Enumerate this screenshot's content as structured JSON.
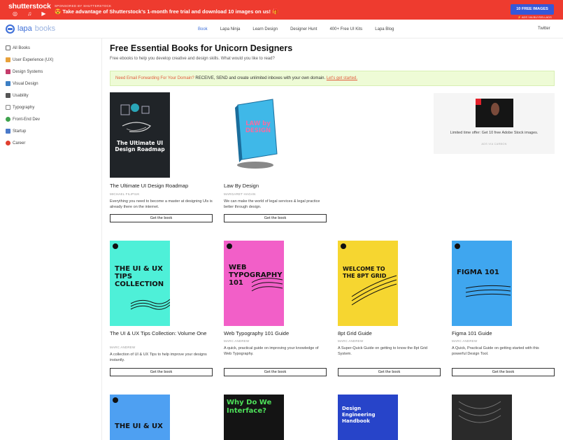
{
  "ad": {
    "logo": "shutterstock",
    "icons": "◎ ♫ ▶",
    "sponsor": "SPONSORED BY SHUTTERSTOCK",
    "text": "😍 Take advantage of Shutterstock's 1-month free trial and download 10 images on us! 🎁",
    "button": "10 FREE IMAGES",
    "via": "⚡ ADS VIA BUYSELLADS"
  },
  "brand": {
    "name": "lapa",
    "sub": "books"
  },
  "nav": {
    "items": [
      "Book",
      "Lapa Ninja",
      "Learn Design",
      "Designer Hunt",
      "400+ Free UI Kits",
      "Lapa Blog"
    ],
    "twitter": "Twitter"
  },
  "sidebar": {
    "items": [
      {
        "label": "All Books",
        "icon": "book-icon",
        "color": "#6a6a6a"
      },
      {
        "label": "User Experience (UX)",
        "icon": "pencil-icon",
        "color": "#e8a13a"
      },
      {
        "label": "Design Systems",
        "icon": "brush-icon",
        "color": "#c43c6b"
      },
      {
        "label": "Visual Design",
        "icon": "palette-icon",
        "color": "#3c7fc4"
      },
      {
        "label": "Usability",
        "icon": "grid-icon",
        "color": "#666666"
      },
      {
        "label": "Typography",
        "icon": "type-icon",
        "color": "#8a8a8a"
      },
      {
        "label": "Front-End Dev",
        "icon": "globe-icon",
        "color": "#3fa34d"
      },
      {
        "label": "Startup",
        "icon": "rocket-icon",
        "color": "#4a79c9"
      },
      {
        "label": "Career",
        "icon": "target-icon",
        "color": "#e0402f"
      }
    ]
  },
  "main": {
    "title": "Free Essential Books for Unicorn Designers",
    "subtitle": "Free ebooks to help you develop creative and design skills. What would you like to read?",
    "promo": {
      "question": "Need Email Forwarding For Your Domain?",
      "body": "RECEIVE, SEND and create unlimited inboxes with your own domain.",
      "link": "Let's get started."
    }
  },
  "books": [
    {
      "title": "The Ultimate UI Design Roadmap",
      "author": "MICHAEL FILIPIUK",
      "desc": "Everything you need to become a master at designing UIs is already there on the internet.",
      "button": "Get the book",
      "cover_text": "The Ultimate UI Design Roadmap",
      "cover_color": "#202428"
    },
    {
      "title": "Law By Design",
      "author": "MARGARET HAGAN",
      "desc": "We can make the world of legal services & legal practice better through design.",
      "button": "Get the book",
      "cover_text": "LAW by DESIGN",
      "cover_color": "#3fb8e8"
    },
    {
      "title": "The UI & UX Tips Collection: Volume One",
      "author": "MARC ANDREW",
      "desc": "A collection of UI & UX Tips to help improve your designs instantly.",
      "button": "Get the book",
      "cover_text": "THE UI & UX TIPS COLLECTION",
      "cover_color": "#4ef0d8"
    },
    {
      "title": "Web Typography 101 Guide",
      "author": "MARC ANDREW",
      "desc": "A quick, practical guide on improving your knowledge of Web Typography.",
      "button": "Get the book",
      "cover_text": "WEB TYPOGRAPHY 101",
      "cover_color": "#f25fc8"
    },
    {
      "title": "8pt Grid Guide",
      "author": "MARC ANDREW",
      "desc": "A Super-Quick Guide on getting to know the 8pt Grid System.",
      "button": "Get the book",
      "cover_text": "WELCOME TO THE 8PT GRID",
      "cover_color": "#f6d630"
    },
    {
      "title": "Figma 101 Guide",
      "author": "MARC ANDREW",
      "desc": "A Quick, Practical Guide on getting started with this powerful Design Tool.",
      "button": "Get the book",
      "cover_text": "FIGMA 101",
      "cover_color": "#3fa6ef"
    }
  ],
  "more_covers": [
    {
      "cover_text": "THE UI & UX",
      "cover_color": "#4ea0f2"
    },
    {
      "cover_text": "Why Do We Interface?",
      "cover_color": "#141414"
    },
    {
      "cover_text": "Design Engineering Handbook",
      "cover_color": "#2744c9"
    },
    {
      "cover_text": "",
      "cover_color": "#2a2a2a"
    }
  ],
  "stock_ad": {
    "text": "Limited time offer: Get 10 free Adobe Stock images.",
    "via": "ADS VIA CARBON"
  }
}
